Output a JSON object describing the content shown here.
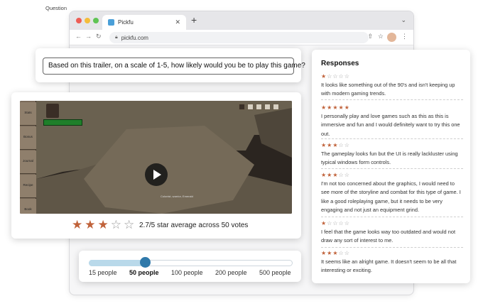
{
  "browser": {
    "tab_title": "Pickfu",
    "url": "pickfu.com"
  },
  "question": {
    "legend": "Question",
    "text": "Based on this trailer, on a scale of 1-5, how likely would you be to play this game?"
  },
  "video": {
    "sidebar_items": [
      "Stats",
      "Bonus",
      "Journal",
      "Recipe",
      "Book"
    ],
    "overlay_text": "Colonist, warrior, Emerald"
  },
  "rating": {
    "filled_stars": 3,
    "total_stars": 5,
    "summary": "2.7/5 star average across 50 votes"
  },
  "audience": {
    "options": [
      "15 people",
      "50 people",
      "100 people",
      "200 people",
      "500 people"
    ],
    "selected": "50 people"
  },
  "responses": {
    "title": "Responses",
    "items": [
      {
        "stars": 1,
        "text": "It looks like something out of the 90's and isn't keeping up with modern gaming trends."
      },
      {
        "stars": 5,
        "text": "I personally play and love games such as this as this is immersive and fun and I would definitely want to try this one out."
      },
      {
        "stars": 3,
        "text": "The gameplay looks fun but the UI is really lackluster using typical windows form controls."
      },
      {
        "stars": 3,
        "text": "I'm not too concerned about the graphics, I would need to see more of the storyline and combat for this type of game. I like a good roleplaying game, but it needs to be very engaging and not just an equipment grind."
      },
      {
        "stars": 1,
        "text": "I feel that the game looks way too outdated and would not draw any sort of interest to me."
      },
      {
        "stars": 3,
        "text": "It seems like an alright game. It doesn't seem to be all that interesting or exciting."
      }
    ]
  },
  "colors": {
    "star_filled": "#c0623a",
    "star_empty": "#9a9a9a",
    "slider_thumb": "#2f79aa",
    "slider_fill": "#b9d9ea"
  },
  "icons": [
    "back-arrow-icon",
    "forward-arrow-icon",
    "reload-icon",
    "lock-icon",
    "share-icon",
    "bookmark-star-icon",
    "menu-dots-icon",
    "play-icon",
    "star-icon"
  ]
}
